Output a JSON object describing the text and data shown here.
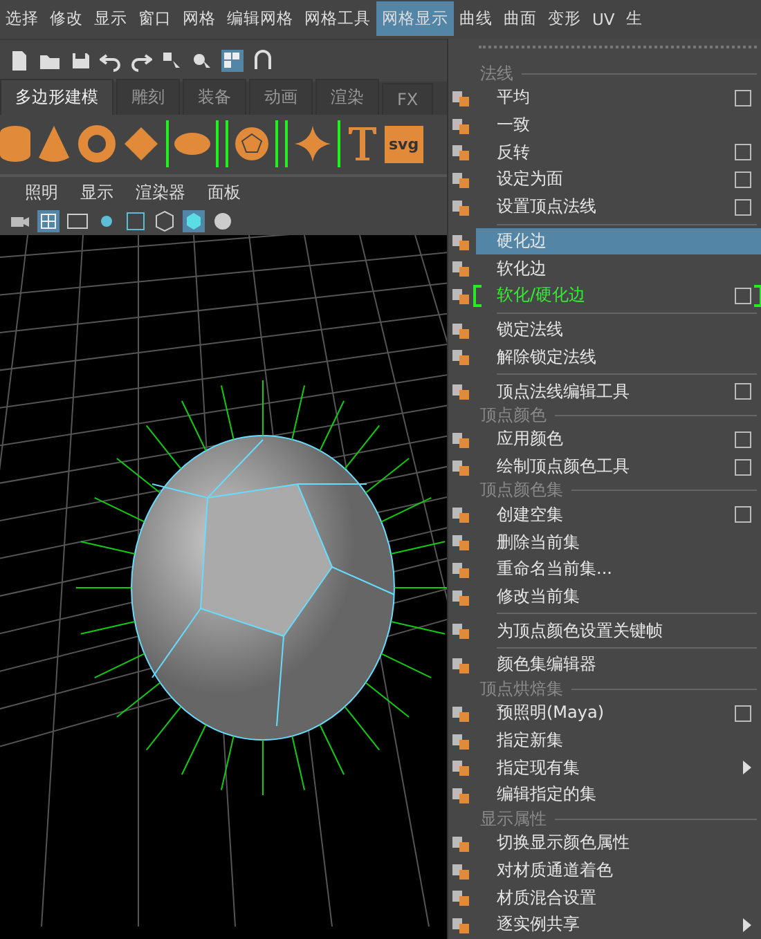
{
  "menu_bar": [
    {
      "label": "选择",
      "selected": false
    },
    {
      "label": "修改",
      "selected": false
    },
    {
      "label": "显示",
      "selected": false
    },
    {
      "label": "窗口",
      "selected": false
    },
    {
      "label": "网格",
      "selected": false
    },
    {
      "label": "编辑网格",
      "selected": false
    },
    {
      "label": "网格工具",
      "selected": false
    },
    {
      "label": "网格显示",
      "selected": true
    },
    {
      "label": "曲线",
      "selected": false
    },
    {
      "label": "曲面",
      "selected": false
    },
    {
      "label": "变形",
      "selected": false
    },
    {
      "label": "UV",
      "selected": false
    },
    {
      "label": "生",
      "selected": false
    }
  ],
  "shelf_tabs": [
    {
      "label": "多边形建模",
      "selected": true
    },
    {
      "label": "雕刻",
      "selected": false
    },
    {
      "label": "装备",
      "selected": false
    },
    {
      "label": "动画",
      "selected": false
    },
    {
      "label": "渲染",
      "selected": false
    },
    {
      "label": "FX",
      "selected": false
    }
  ],
  "shelf": {
    "icon_text": "svg"
  },
  "panel_menu": [
    "照明",
    "显示",
    "渲染器",
    "面板"
  ],
  "dropdown": [
    {
      "kind": "section",
      "label": "法线"
    },
    {
      "kind": "item",
      "label": "平均",
      "option_box": true,
      "submenu": false,
      "selected": false,
      "marked": false
    },
    {
      "kind": "item",
      "label": "一致",
      "option_box": false,
      "submenu": false,
      "selected": false,
      "marked": false
    },
    {
      "kind": "item",
      "label": "反转",
      "option_box": true,
      "submenu": false,
      "selected": false,
      "marked": false
    },
    {
      "kind": "item",
      "label": "设定为面",
      "option_box": true,
      "submenu": false,
      "selected": false,
      "marked": false
    },
    {
      "kind": "item",
      "label": "设置顶点法线",
      "option_box": true,
      "submenu": false,
      "selected": false,
      "marked": false
    },
    {
      "kind": "separator"
    },
    {
      "kind": "item",
      "label": "硬化边",
      "option_box": false,
      "submenu": false,
      "selected": true,
      "marked": false
    },
    {
      "kind": "item",
      "label": "软化边",
      "option_box": false,
      "submenu": false,
      "selected": false,
      "marked": false
    },
    {
      "kind": "item",
      "label": "软化/硬化边",
      "option_box": true,
      "submenu": false,
      "selected": false,
      "marked": true
    },
    {
      "kind": "separator"
    },
    {
      "kind": "item",
      "label": "锁定法线",
      "option_box": false,
      "submenu": false,
      "selected": false,
      "marked": false
    },
    {
      "kind": "item",
      "label": "解除锁定法线",
      "option_box": false,
      "submenu": false,
      "selected": false,
      "marked": false
    },
    {
      "kind": "separator"
    },
    {
      "kind": "item",
      "label": "顶点法线编辑工具",
      "option_box": true,
      "submenu": false,
      "selected": false,
      "marked": false
    },
    {
      "kind": "section",
      "label": "顶点颜色"
    },
    {
      "kind": "item",
      "label": "应用颜色",
      "option_box": true,
      "submenu": false,
      "selected": false,
      "marked": false
    },
    {
      "kind": "item",
      "label": "绘制顶点颜色工具",
      "option_box": true,
      "submenu": false,
      "selected": false,
      "marked": false
    },
    {
      "kind": "section",
      "label": "顶点颜色集"
    },
    {
      "kind": "item",
      "label": "创建空集",
      "option_box": true,
      "submenu": false,
      "selected": false,
      "marked": false
    },
    {
      "kind": "item",
      "label": "删除当前集",
      "option_box": false,
      "submenu": false,
      "selected": false,
      "marked": false
    },
    {
      "kind": "item",
      "label": "重命名当前集...",
      "option_box": false,
      "submenu": false,
      "selected": false,
      "marked": false
    },
    {
      "kind": "item",
      "label": "修改当前集",
      "option_box": false,
      "submenu": false,
      "selected": false,
      "marked": false
    },
    {
      "kind": "separator"
    },
    {
      "kind": "item",
      "label": "为顶点颜色设置关键帧",
      "option_box": false,
      "submenu": false,
      "selected": false,
      "marked": false
    },
    {
      "kind": "separator"
    },
    {
      "kind": "item",
      "label": "颜色集编辑器",
      "option_box": false,
      "submenu": false,
      "selected": false,
      "marked": false
    },
    {
      "kind": "section",
      "label": "顶点烘焙集"
    },
    {
      "kind": "item",
      "label": "预照明(Maya)",
      "option_box": true,
      "submenu": false,
      "selected": false,
      "marked": false
    },
    {
      "kind": "item",
      "label": "指定新集",
      "option_box": false,
      "submenu": false,
      "selected": false,
      "marked": false
    },
    {
      "kind": "item",
      "label": "指定现有集",
      "option_box": false,
      "submenu": true,
      "selected": false,
      "marked": false
    },
    {
      "kind": "item",
      "label": "编辑指定的集",
      "option_box": false,
      "submenu": false,
      "selected": false,
      "marked": false
    },
    {
      "kind": "section",
      "label": "显示属性"
    },
    {
      "kind": "item",
      "label": "切换显示颜色属性",
      "option_box": false,
      "submenu": false,
      "selected": false,
      "marked": false
    },
    {
      "kind": "item",
      "label": "对材质通道着色",
      "option_box": false,
      "submenu": false,
      "selected": false,
      "marked": false
    },
    {
      "kind": "item",
      "label": "材质混合设置",
      "option_box": false,
      "submenu": false,
      "selected": false,
      "marked": false
    },
    {
      "kind": "item",
      "label": "逐实例共享",
      "option_box": false,
      "submenu": true,
      "selected": false,
      "marked": false
    }
  ]
}
